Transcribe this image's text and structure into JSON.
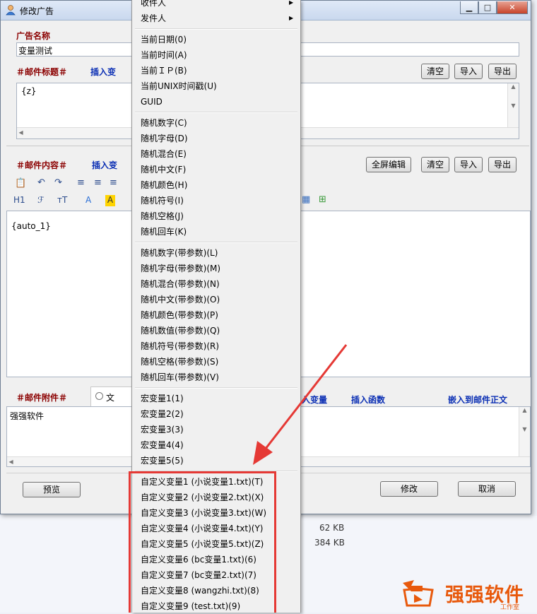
{
  "window": {
    "title": "修改广告",
    "controls": [
      "minimize",
      "maximize",
      "close"
    ]
  },
  "ad_name": {
    "label": "广告名称",
    "value": "变量测试"
  },
  "subject": {
    "label": "＃邮件标题＃",
    "insert_link": "插入变",
    "value": "{z}",
    "buttons": {
      "clear": "清空",
      "import": "导入",
      "export": "导出"
    }
  },
  "content": {
    "label": "＃邮件内容＃",
    "insert_link": "插入变",
    "value": "{auto_1}",
    "buttons": {
      "fullscreen": "全屏编辑",
      "clear": "清空",
      "import": "导入",
      "export": "导出"
    },
    "toolbar_row2": {
      "heading": "H1",
      "font": "ℱ",
      "size": "тT",
      "font_color": "A",
      "highlight": "A"
    }
  },
  "attachment": {
    "label": "＃邮件附件＃",
    "radio_label": "文",
    "value": "强强软件",
    "links": {
      "insert_var": "入变量",
      "insert_func": "插入函数",
      "embed": "嵌入到邮件正文"
    }
  },
  "footer": {
    "preview": "预览",
    "modify": "修改",
    "cancel": "取消"
  },
  "background": {
    "size_1": "62 KB",
    "size_2": "384 KB"
  },
  "menu": {
    "group_top": [
      {
        "label": "收件人",
        "submenu": true
      },
      {
        "label": "发件人",
        "submenu": true
      }
    ],
    "group_time": [
      "当前日期(0)",
      "当前时间(A)",
      "当前ＩＰ(B)",
      "当前UNIX时间戳(U)",
      "GUID"
    ],
    "group_random": [
      "随机数字(C)",
      "随机字母(D)",
      "随机混合(E)",
      "随机中文(F)",
      "随机颜色(H)",
      "随机符号(I)",
      "随机空格(J)",
      "随机回车(K)"
    ],
    "group_random_params": [
      "随机数字(带参数)(L)",
      "随机字母(带参数)(M)",
      "随机混合(带参数)(N)",
      "随机中文(带参数)(O)",
      "随机颜色(带参数)(P)",
      "随机数值(带参数)(Q)",
      "随机符号(带参数)(R)",
      "随机空格(带参数)(S)",
      "随机回车(带参数)(V)"
    ],
    "group_macro": [
      "宏变量1(1)",
      "宏变量2(2)",
      "宏变量3(3)",
      "宏变量4(4)",
      "宏变量5(5)"
    ],
    "group_custom": [
      "自定义变量1 (小说变量1.txt)(T)",
      "自定义变量2 (小说变量2.txt)(X)",
      "自定义变量3 (小说变量3.txt)(W)",
      "自定义变量4 (小说变量4.txt)(Y)",
      "自定义变量5 (小说变量5.txt)(Z)",
      "自定义变量6 (bc变量1.txt)(6)",
      "自定义变量7 (bc变量2.txt)(7)",
      "自定义变量8 (wangzhi.txt)(8)",
      "自定义变量9 (test.txt)(9)"
    ]
  },
  "watermark": {
    "text": "强强软件",
    "sub": "工作室"
  },
  "colors": {
    "annotation": "#e53935",
    "label_red": "#8b0000",
    "label_blue": "#0b2fb4",
    "watermark": "#e8590c"
  }
}
